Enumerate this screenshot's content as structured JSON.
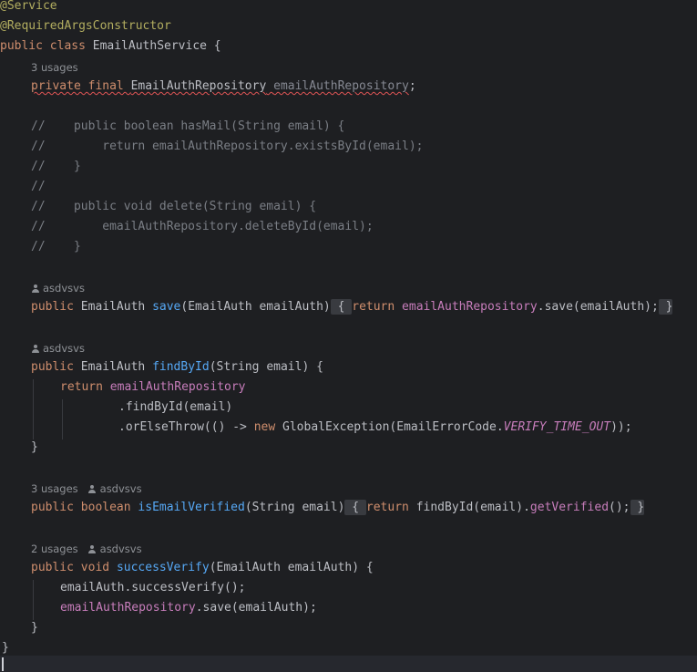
{
  "code": {
    "annotation_service": "@Service",
    "annotation_ctor": "@RequiredArgsConstructor",
    "class_keywords": "public class ",
    "class_name": "EmailAuthService",
    "class_open": " {",
    "usages_3": "3 usages",
    "usages_2": "2 usages",
    "author": "asdvsvs",
    "field_kw": "private final ",
    "field_type": "EmailAuthRepository",
    "field_name": "emailAuthRepository",
    "field_semi": ";",
    "cmt1": "//    public boolean hasMail(String email) {",
    "cmt2": "//        return emailAuthRepository.existsById(email);",
    "cmt3": "//    }",
    "cmt4": "//",
    "cmt5": "//    public void delete(String email) {",
    "cmt6": "//        emailAuthRepository.deleteById(email);",
    "cmt7": "//    }",
    "kw_public": "public ",
    "kw_return": "return ",
    "kw_new": "new ",
    "kw_boolean": "boolean ",
    "kw_void": "void ",
    "type_emailauth": "EmailAuth ",
    "save_name": "save",
    "save_params": "(EmailAuth emailAuth)",
    "fold_open": " { ",
    "fold_close": " }",
    "repo": "emailAuthRepository",
    "dot_save_call": ".save(emailAuth);",
    "find_name": "findById",
    "find_params": "(String email) {",
    "chain1": ".findById(email)",
    "chain2_a": ".orElseThrow(() -> ",
    "chain2_b": "GlobalException(EmailErrorCode.",
    "chain2_const": "VERIFY_TIME_OUT",
    "chain2_end": "));",
    "brace_close": "}",
    "isverified_name": "isEmailVerified",
    "isverified_params": "(String email)",
    "isverified_body_a": "findById(email).",
    "isverified_body_b": "getVerified",
    "isverified_body_c": "();",
    "success_name": "successVerify",
    "success_params": "(EmailAuth emailAuth) {",
    "success_line1": "emailAuth.successVerify();",
    "save_call": ".save(emailAuth);"
  }
}
